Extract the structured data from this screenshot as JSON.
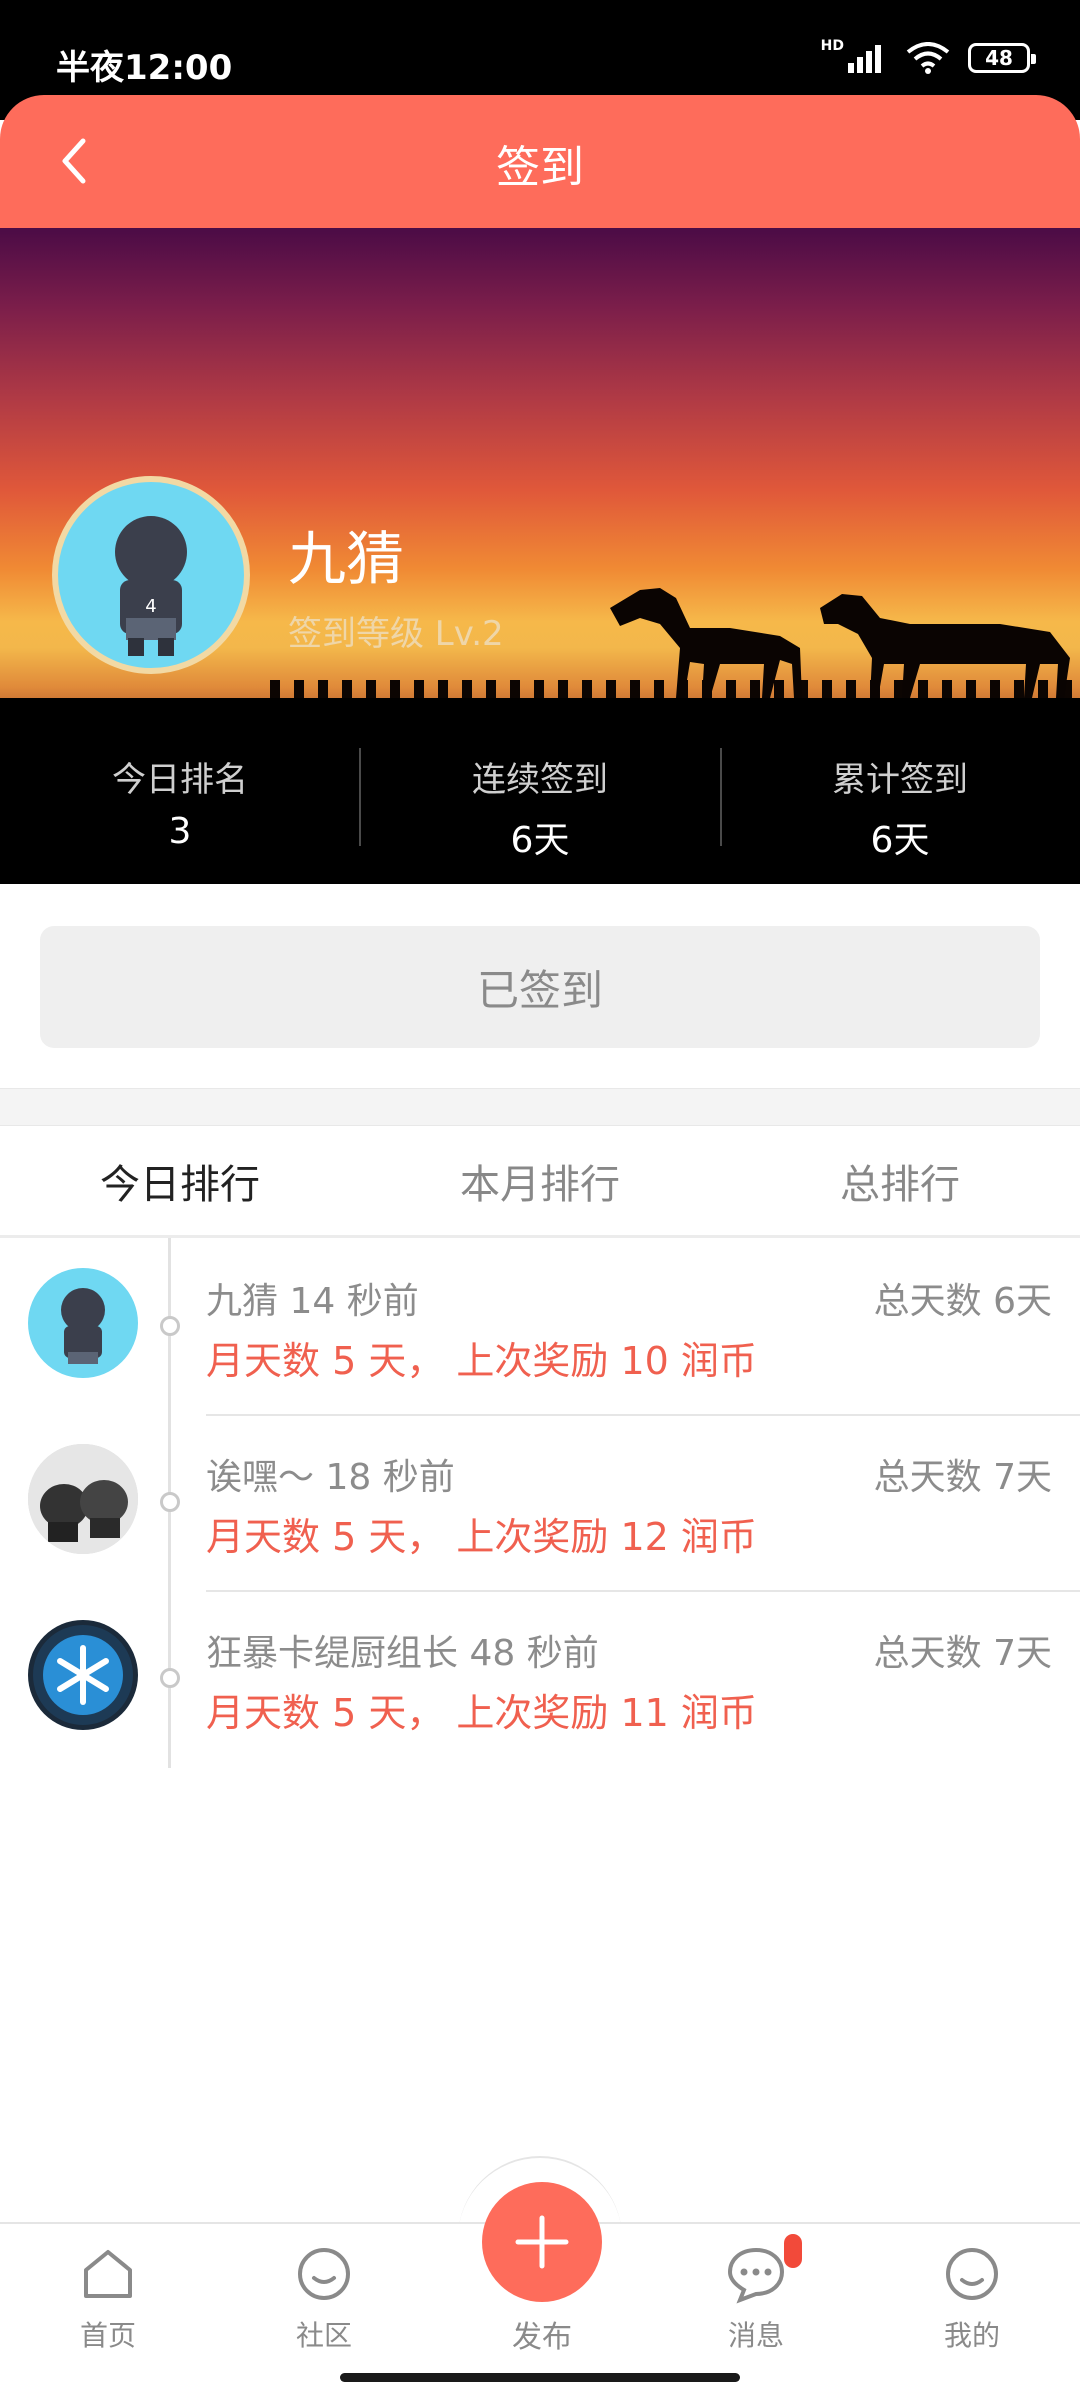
{
  "status_bar": {
    "time": "半夜12:00",
    "network": "HD",
    "battery": "48"
  },
  "header": {
    "title": "签到"
  },
  "profile": {
    "name": "九猜",
    "level": "签到等级 Lv.2"
  },
  "stats": [
    {
      "label": "今日排名",
      "value": "3"
    },
    {
      "label": "连续签到",
      "value": "6天"
    },
    {
      "label": "累计签到",
      "value": "6天"
    }
  ],
  "checkin_button": {
    "label": "已签到"
  },
  "tabs": [
    {
      "label": "今日排行",
      "active": true
    },
    {
      "label": "本月排行",
      "active": false
    },
    {
      "label": "总排行",
      "active": false
    }
  ],
  "rankings": [
    {
      "name": "九猜",
      "time": "14 秒前",
      "total": "总天数 6天",
      "detail": "月天数 5 天， 上次奖励 10 润币",
      "avatar": "boy-avatar"
    },
    {
      "name": "诶嘿～",
      "time": "18 秒前",
      "total": "总天数 7天",
      "detail": "月天数 5 天， 上次奖励 12 润币",
      "avatar": "boxing-gloves-avatar"
    },
    {
      "name": "狂暴卡缇厨组长",
      "time": "48 秒前",
      "total": "总天数 7天",
      "detail": "月天数 5 天， 上次奖励 11 润币",
      "avatar": "snowflake-badge-avatar"
    }
  ],
  "bottom_nav": {
    "home": "首页",
    "community": "社区",
    "publish": "发布",
    "messages": "消息",
    "mine": "我的"
  },
  "colors": {
    "accent": "#fe6c5b",
    "reward_text": "#f0604f"
  }
}
